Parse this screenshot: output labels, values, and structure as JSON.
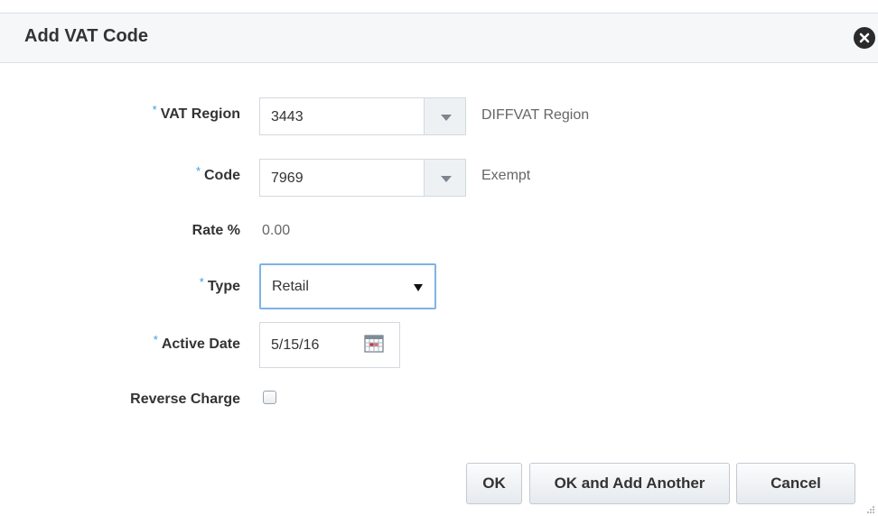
{
  "dialog": {
    "title": "Add VAT Code",
    "close_icon": "close-circle-icon"
  },
  "form": {
    "vat_region": {
      "label": "VAT Region",
      "required": true,
      "value": "3443",
      "description": "DIFFVAT Region"
    },
    "code": {
      "label": "Code",
      "required": true,
      "value": "7969",
      "description": "Exempt"
    },
    "rate": {
      "label": "Rate %",
      "value": "0.00"
    },
    "type": {
      "label": "Type",
      "required": true,
      "value": "Retail"
    },
    "active_date": {
      "label": "Active Date",
      "required": true,
      "value": "5/15/16",
      "icon": "calendar-icon"
    },
    "reverse_charge": {
      "label": "Reverse Charge",
      "checked": false
    }
  },
  "required_marker": "*",
  "buttons": {
    "ok": "OK",
    "ok_add_another": "OK and Add Another",
    "cancel": "Cancel"
  },
  "colors": {
    "required_marker": "#3c9be0",
    "focus_border": "#7fb3e6",
    "header_bg": "#f5f7f9"
  }
}
